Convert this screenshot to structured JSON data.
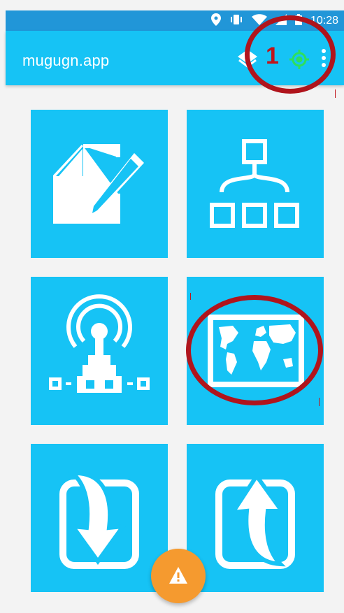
{
  "status_bar": {
    "time": "10:28",
    "icons": [
      "location-icon",
      "vibrate-icon",
      "wifi-icon",
      "signal-icon",
      "battery-icon"
    ]
  },
  "app_bar": {
    "title": "mugugn.app",
    "layers_icon": "layers-icon",
    "gps_count": "1",
    "gps_icon": "gps-icon",
    "menu_icon": "more-vert-icon"
  },
  "tiles": [
    {
      "name": "notes",
      "icon": "note-edit-icon"
    },
    {
      "name": "forms",
      "icon": "hierarchy-icon"
    },
    {
      "name": "tracking",
      "icon": "antenna-icon"
    },
    {
      "name": "map",
      "icon": "world-map-icon"
    },
    {
      "name": "import",
      "icon": "import-icon"
    },
    {
      "name": "export",
      "icon": "export-icon"
    }
  ],
  "fab": {
    "icon": "warning-icon"
  },
  "colors": {
    "status_bar": "#2196d8",
    "app_bar": "#16c3f5",
    "tile": "#16c3f5",
    "gps_accent": "#2ee05a",
    "annotation": "#b0141c",
    "fab": "#f59a2f"
  }
}
